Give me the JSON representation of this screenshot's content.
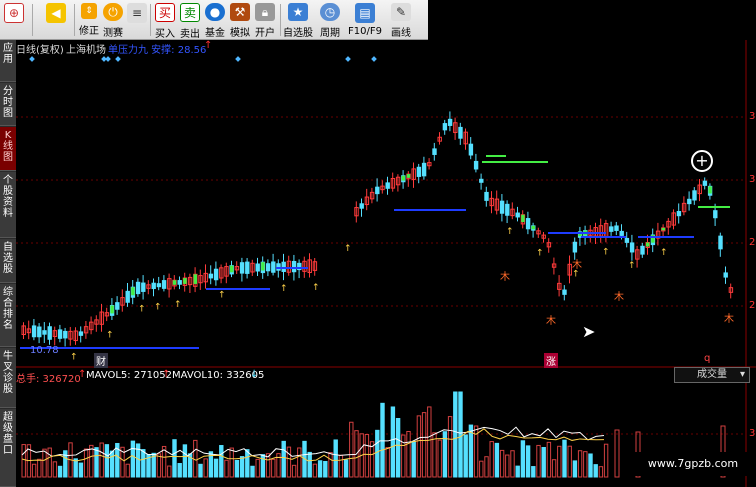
{
  "toolbar": {
    "items": [
      {
        "label": "",
        "icon": "apps-icon"
      },
      {
        "label": "",
        "icon": "back-arrow-icon"
      },
      {
        "label": "修正",
        "icon": "up-down-icon"
      },
      {
        "label": "测赛",
        "icon": "power-icon"
      },
      {
        "label": "买入",
        "icon": "buy-icon",
        "glyph": "买"
      },
      {
        "label": "卖出",
        "icon": "sell-icon",
        "glyph": "卖"
      },
      {
        "label": "基金",
        "icon": "fund-icon"
      },
      {
        "label": "模拟",
        "icon": "hammer-icon"
      },
      {
        "label": "开户",
        "icon": "lock-icon"
      },
      {
        "label": "自选股",
        "icon": "star-folder-icon"
      },
      {
        "label": "周期",
        "icon": "clock-icon"
      },
      {
        "label": "F10/F9",
        "icon": "f10-icon"
      },
      {
        "label": "画线",
        "icon": "pencil-icon"
      }
    ]
  },
  "left_tabs": [
    {
      "label": "应用",
      "active": false
    },
    {
      "label": "分时图",
      "active": false
    },
    {
      "label": "K线图",
      "active": true
    },
    {
      "label": "个股资料",
      "active": false
    },
    {
      "label": "自选股",
      "active": false
    },
    {
      "label": "综合排名",
      "active": false
    },
    {
      "label": "牛叉诊股",
      "active": false
    },
    {
      "label": "超级盘口",
      "active": false
    }
  ],
  "chart": {
    "title": "日线(复权)",
    "stock": "上海机场",
    "indicator_text": "单压力九 安撑: 28.56",
    "low_label": "10.78",
    "marker_cai": "财",
    "marker_zhang": "涨",
    "marker_q": "q",
    "axis_labels": [
      "3",
      "3",
      "2",
      "2"
    ],
    "vol_axis_label": "3",
    "up_color": "#ff3b3b",
    "down_color": "#55e0ff",
    "line_color": "#1e3cff",
    "green_color": "#44ee44"
  },
  "volume": {
    "total_label": "总手: 326720",
    "mavol5_label": "MAVOL5: 271052",
    "mavol10_label": "MAVOL10: 332605",
    "dropdown": "成交量"
  },
  "watermark": "www.7gpzb.com"
}
